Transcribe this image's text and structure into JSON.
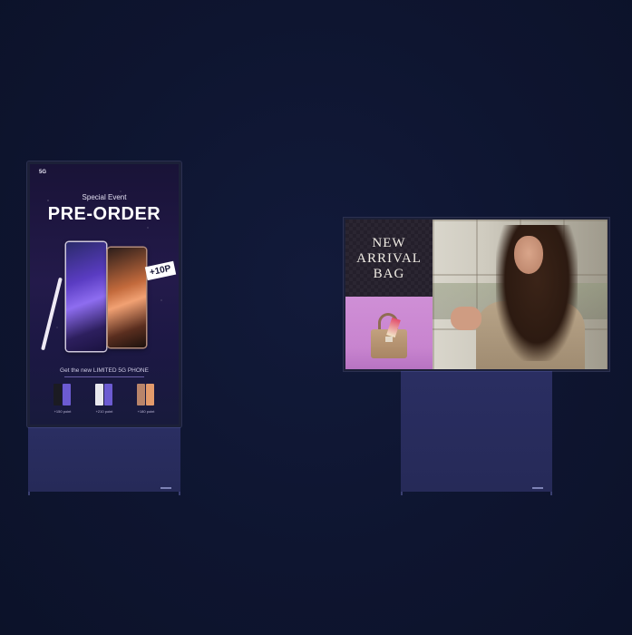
{
  "left_tv": {
    "network_badge": "5G",
    "event_label": "Special Event",
    "headline": "PRE-ORDER",
    "points_tag": "+10P",
    "caption": "Get the new LIMITED 5G PHONE",
    "variants": [
      {
        "points": "+150 point",
        "color_a": "#1b1b22",
        "color_b": "#6c5bd1"
      },
      {
        "points": "+210 point",
        "color_a": "#e8e8ee",
        "color_b": "#6c5bd1"
      },
      {
        "points": "+180 point",
        "color_a": "#b9846a",
        "color_b": "#e39a6b"
      }
    ]
  },
  "right_tv": {
    "headline_lines": [
      "NEW",
      "ARRIVAL",
      "BAG"
    ]
  },
  "colors": {
    "background": "#0e1530",
    "stand": "#2a2e62"
  }
}
